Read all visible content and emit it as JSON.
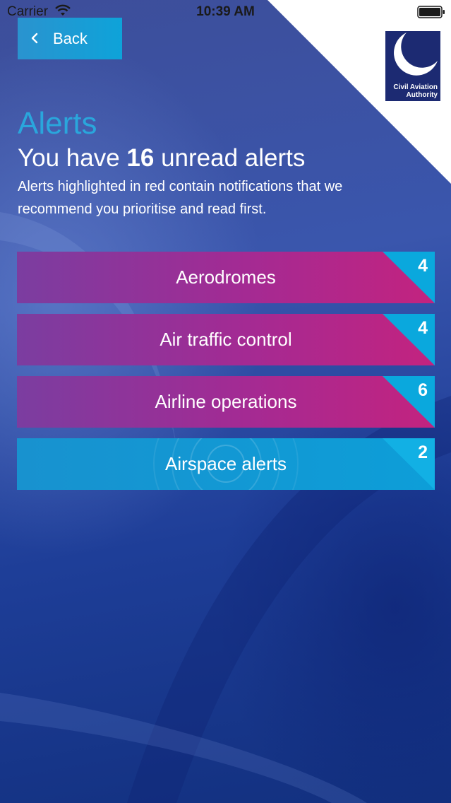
{
  "status_bar": {
    "carrier": "Carrier",
    "time": "10:39 AM"
  },
  "logo": {
    "line1": "Civil Aviation",
    "line2": "Authority"
  },
  "nav": {
    "back_label": "Back"
  },
  "header": {
    "title": "Alerts",
    "unread_prefix": "You have ",
    "unread_count": "16",
    "unread_suffix": " unread alerts",
    "intro": "Alerts highlighted in red contain notifications that we recommend you prioritise and read first."
  },
  "categories": [
    {
      "label": "Aerodromes",
      "count": "4",
      "style": "magenta"
    },
    {
      "label": "Air traffic control",
      "count": "4",
      "style": "magenta"
    },
    {
      "label": "Airline operations",
      "count": "6",
      "style": "magenta"
    },
    {
      "label": "Airspace alerts",
      "count": "2",
      "style": "blue"
    }
  ],
  "colors": {
    "title_blue": "#2aa6dc",
    "badge_cyan": "#0aa8dd",
    "magenta": "#c3237f",
    "logo_navy": "#1c2a72"
  }
}
